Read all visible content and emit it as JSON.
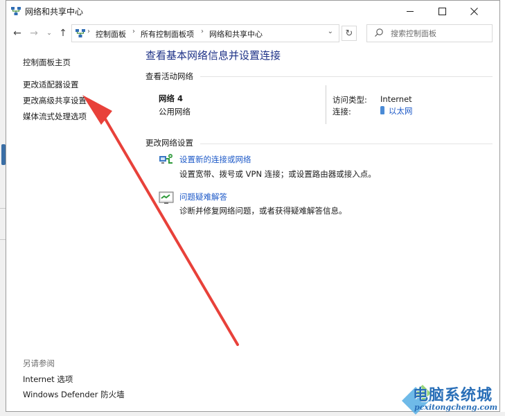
{
  "window": {
    "title": "网络和共享中心"
  },
  "addressbar": {
    "crumbs": [
      "控制面板",
      "所有控制面板项",
      "网络和共享中心"
    ]
  },
  "search": {
    "placeholder": "搜索控制面板"
  },
  "leftnav": {
    "items": [
      "控制面板主页",
      "更改适配器设置",
      "更改高级共享设置",
      "媒体流式处理选项"
    ],
    "see_also_title": "另请参阅",
    "see_also": [
      "Internet 选项",
      "Windows Defender 防火墙"
    ]
  },
  "main": {
    "title": "查看基本网络信息并设置连接",
    "active_networks_heading": "查看活动网络",
    "network": {
      "name": "网络 4",
      "category": "公用网络",
      "access_type_label": "访问类型:",
      "access_type_value": "Internet",
      "connections_label": "连接:",
      "connection_value": "以太网"
    },
    "change_settings_heading": "更改网络设置",
    "tasks": [
      {
        "link": "设置新的连接或网络",
        "desc": "设置宽带、拨号或 VPN 连接；或设置路由器或接入点。"
      },
      {
        "link": "问题疑难解答",
        "desc": "诊断并修复网络问题，或者获得疑难解答信息。"
      }
    ]
  },
  "watermark": {
    "main": "电脑系统城",
    "sub": "pcxitongcheng.com"
  },
  "colors": {
    "link": "#1e5ac8",
    "title": "#1e3287",
    "arrow": "#e8413a"
  }
}
